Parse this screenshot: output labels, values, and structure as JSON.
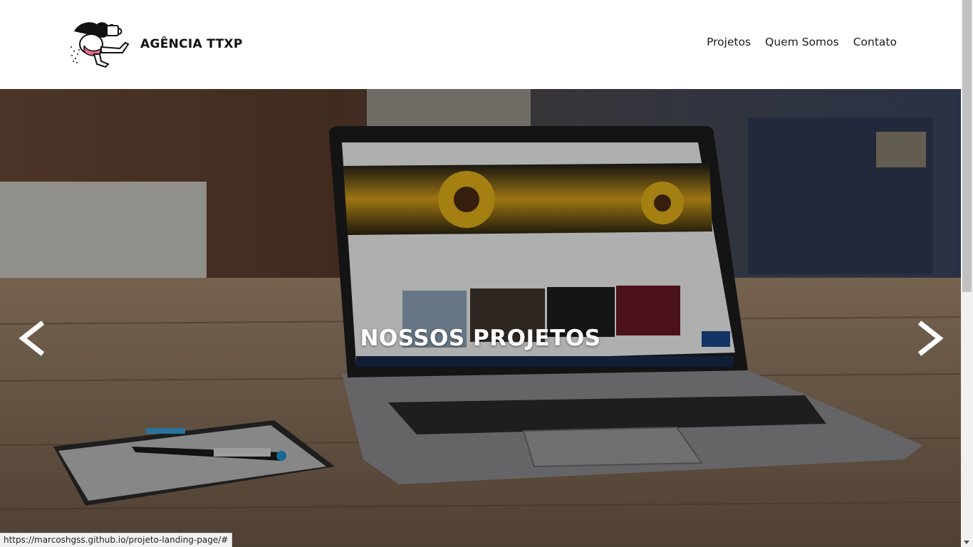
{
  "header": {
    "brand": "AGÊNCIA TTXP",
    "nav": [
      {
        "label": "Projetos"
      },
      {
        "label": "Quem Somos"
      },
      {
        "label": "Contato"
      }
    ]
  },
  "hero": {
    "title": "NOSSOS PROJETOS",
    "prev_icon": "chevron-left-icon",
    "next_icon": "chevron-right-icon"
  },
  "status_bar": {
    "url": "https://marcoshgss.github.io/projeto-landing-page/#"
  },
  "colors": {
    "header_bg": "#ffffff",
    "text": "#111111",
    "hero_text": "#ffffff"
  }
}
